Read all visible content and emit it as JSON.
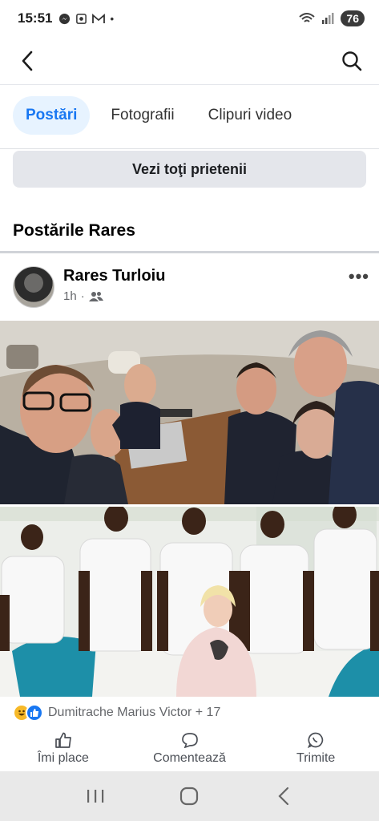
{
  "status": {
    "time": "15:51",
    "battery": "76",
    "left_icons": [
      "messenger-icon",
      "screenshot-icon",
      "gmail-icon",
      "dot-icon"
    ],
    "right_icons": [
      "wifi-icon",
      "signal-icon"
    ]
  },
  "topnav": {
    "back_icon": "back-arrow-icon",
    "search_icon": "search-icon"
  },
  "tabs": [
    {
      "label": "Postări",
      "active": true
    },
    {
      "label": "Fotografii",
      "active": false
    },
    {
      "label": "Clipuri video",
      "active": false
    }
  ],
  "friends_button": "Vezi toţi prietenii",
  "section_title": "Postările Rares",
  "post": {
    "author": "Rares Turloiu",
    "time": "1h",
    "separator": "·",
    "audience_icon": "friends-icon",
    "more_label": "•••"
  },
  "reactions": {
    "text": "Dumitrache Marius Victor + 17",
    "icons": [
      "haha-icon",
      "like-icon"
    ]
  },
  "actions": [
    {
      "label": "Îmi place",
      "icon": "thumbs-up-icon"
    },
    {
      "label": "Comentează",
      "icon": "comment-icon"
    },
    {
      "label": "Trimite",
      "icon": "whatsapp-icon"
    }
  ],
  "colors": {
    "accent": "#1877f2",
    "tab_active_bg": "#e7f3ff",
    "button_bg": "#e4e6eb",
    "secondary_text": "#65676b"
  }
}
